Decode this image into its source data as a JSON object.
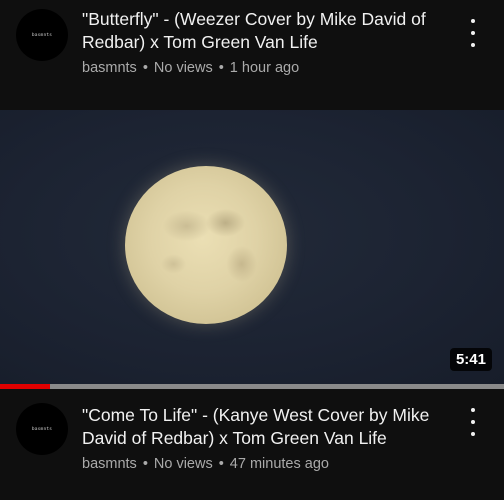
{
  "videos": [
    {
      "avatar_text": "basmnts",
      "title": "\"Butterfly\" - (Weezer Cover by Mike David of Redbar) x Tom Green Van Life",
      "channel": "basmnts",
      "views": "No views",
      "age": "1 hour ago",
      "separator": "•"
    },
    {
      "avatar_text": "basmnts",
      "title": "\"Come To Life\" - (Kanye West Cover by Mike David of Redbar) x Tom Green Van Life",
      "channel": "basmnts",
      "views": "No views",
      "age": "47 minutes ago",
      "separator": "•",
      "duration": "5:41",
      "watch_progress": 0.1,
      "thumbnail_icon": "full-moon-image"
    }
  ],
  "colors": {
    "background": "#0f0f0f",
    "progress": "#e00000",
    "meta_text": "#aaaaaa"
  }
}
